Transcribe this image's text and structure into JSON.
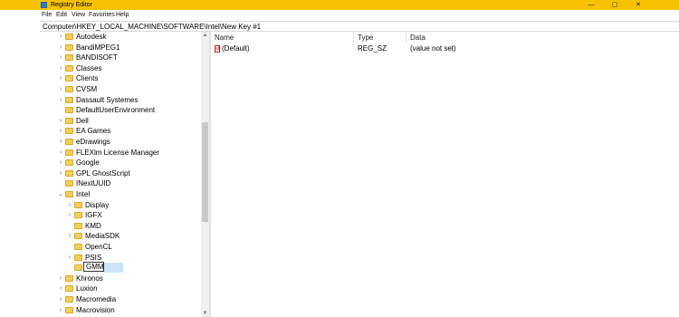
{
  "window": {
    "title": "Registry Editor",
    "controls": {
      "minimize": "—",
      "maximize": "▢",
      "close": "✕"
    }
  },
  "menu": [
    "File",
    "Edit",
    "View",
    "Favorites",
    "Help"
  ],
  "address": {
    "path": "Computer\\HKEY_LOCAL_MACHINE\\SOFTWARE\\Intel\\New Key #1"
  },
  "tree": {
    "items": [
      {
        "label": "Autodesk",
        "expandable": true
      },
      {
        "label": "BandiMPEG1",
        "expandable": true
      },
      {
        "label": "BANDISOFT",
        "expandable": true
      },
      {
        "label": "Classes",
        "expandable": true
      },
      {
        "label": "Clients",
        "expandable": true
      },
      {
        "label": "CVSM",
        "expandable": true
      },
      {
        "label": "Dassault Systemes",
        "expandable": true
      },
      {
        "label": "DefaultUserEnvironment",
        "expandable": false
      },
      {
        "label": "Dell",
        "expandable": true
      },
      {
        "label": "EA Games",
        "expandable": true
      },
      {
        "label": "eDrawings",
        "expandable": true
      },
      {
        "label": "FLEXlm License Manager",
        "expandable": true
      },
      {
        "label": "Google",
        "expandable": true
      },
      {
        "label": "GPL GhostScript",
        "expandable": true
      },
      {
        "label": "INextUUID",
        "expandable": false
      },
      {
        "label": "Intel",
        "expandable": true,
        "expanded": true
      },
      {
        "label": "Display",
        "expandable": true,
        "child": true
      },
      {
        "label": "IGFX",
        "expandable": true,
        "child": true
      },
      {
        "label": "KMD",
        "expandable": false,
        "child": true
      },
      {
        "label": "MediaSDK",
        "expandable": true,
        "child": true
      },
      {
        "label": "OpenCL",
        "expandable": false,
        "child": true
      },
      {
        "label": "PSIS",
        "expandable": true,
        "child": true
      },
      {
        "label": "GMM",
        "expandable": false,
        "child": true,
        "editing": true
      },
      {
        "label": "Khronos",
        "expandable": true
      },
      {
        "label": "Luxion",
        "expandable": true
      },
      {
        "label": "Macromedia",
        "expandable": true
      },
      {
        "label": "Macrovision",
        "expandable": true
      }
    ]
  },
  "list": {
    "columns": [
      "Name",
      "Type",
      "Data"
    ],
    "rows": [
      {
        "name": "(Default)",
        "type": "REG_SZ",
        "data": "(value not set)",
        "icon": "string-value-icon"
      }
    ]
  },
  "colors": {
    "titlebar": "#f6c200",
    "folder": "#f3cf5a",
    "selection": "#cce4f7"
  },
  "icons": {
    "app": "registry-editor-icon",
    "folder": "folder-icon",
    "expand": "chevron-right-icon",
    "collapse": "chevron-down-icon"
  }
}
